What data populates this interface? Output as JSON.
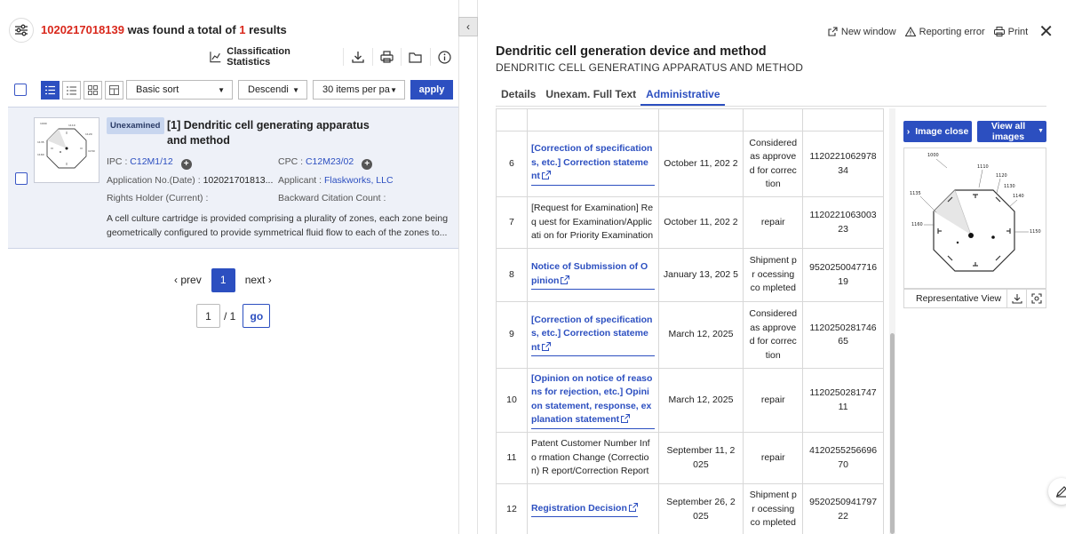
{
  "search": {
    "query_number": "1020217018139",
    "found_text": " was found a total of ",
    "count": "1",
    "results_text": " results"
  },
  "toolbar": {
    "classification_label": "Classification Statistics",
    "sort_value": "Basic sort",
    "order_value": "Descendi",
    "perpage_value": "30 items per pa",
    "apply_label": "apply"
  },
  "result": {
    "badge": "Unexamined",
    "title": "[1] Dendritic cell generating apparatus and method",
    "ipc_label": "IPC",
    "ipc_value": "C12M1/12",
    "cpc_label": "CPC",
    "cpc_value": "C12M23/02",
    "appno_label": "Application No.(Date)",
    "appno_value": "102021701813...",
    "applicant_label": "Applicant",
    "applicant_value": "Flaskworks, LLC",
    "rights_label": "Rights Holder (Current)",
    "citation_label": "Backward Citation Count",
    "colon": ":",
    "abstract": "A cell culture cartridge is provided comprising a plurality of zones, each zone being geometrically configured to provide symmetrical fluid flow to each of the zones to..."
  },
  "pagination": {
    "prev": "prev",
    "current": "1",
    "next": "next",
    "goto_value": "1",
    "total": "/ 1",
    "go": "go"
  },
  "detail": {
    "topbar": {
      "new_window": "New window",
      "report": "Reporting error",
      "print": "Print"
    },
    "title": "Dendritic cell generation device and method",
    "subtitle": "DENDRITIC CELL GENERATING APPARATUS AND METHOD",
    "tabs": [
      {
        "label": "Details"
      },
      {
        "label": "Unexam. Full Text"
      },
      {
        "label": "Administrative"
      }
    ],
    "rows": [
      {
        "num": "6",
        "doc": "[Correction of specification s, etc.] Correction stateme nt",
        "link": true,
        "date": "October 11, 202 2",
        "status": "Considered as approve d for correc tion",
        "no": "1120221062978 34"
      },
      {
        "num": "7",
        "doc": "[Request for Examination] Req uest for Examination/Applicati on for Priority Examination",
        "link": false,
        "date": "October 11, 202 2",
        "status": "repair",
        "no": "1120221063003 23"
      },
      {
        "num": "8",
        "doc": "Notice of Submission of O pinion",
        "link": true,
        "date": "January 13, 202 5",
        "status": "Shipment pr ocessing co mpleted",
        "no": "9520250047716 19"
      },
      {
        "num": "9",
        "doc": "[Correction of specification s, etc.] Correction stateme nt",
        "link": true,
        "date": "March 12, 2025",
        "status": "Considered as approve d for correc tion",
        "no": "1120250281746 65"
      },
      {
        "num": "10",
        "doc": "[Opinion on notice of reaso ns for rejection, etc.] Opini on statement, response, ex planation statement",
        "link": true,
        "date": "March 12, 2025",
        "status": "repair",
        "no": "1120250281747 11"
      },
      {
        "num": "11",
        "doc": "Patent Customer Number Info rmation Change (Correction) R eport/Correction Report",
        "link": false,
        "date": "September 11, 2 025",
        "status": "repair",
        "no": "4120255256696 70"
      },
      {
        "num": "12",
        "doc": "Registration Decision",
        "link": true,
        "date": "September 26, 2 025",
        "status": "Shipment pr ocessing co mpleted",
        "no": "9520250941797 22"
      }
    ],
    "image_panel": {
      "close_label": "Image close",
      "view_all_label": "View all images",
      "caption": "Representative View",
      "figure_labels": [
        "1000",
        "1110",
        "1120",
        "1130",
        "1135",
        "1140",
        "1150",
        "1160"
      ]
    }
  },
  "colors": {
    "accent": "#2c4fc0",
    "highlight": "#d9281c",
    "row_bg": "#eef1f8"
  }
}
